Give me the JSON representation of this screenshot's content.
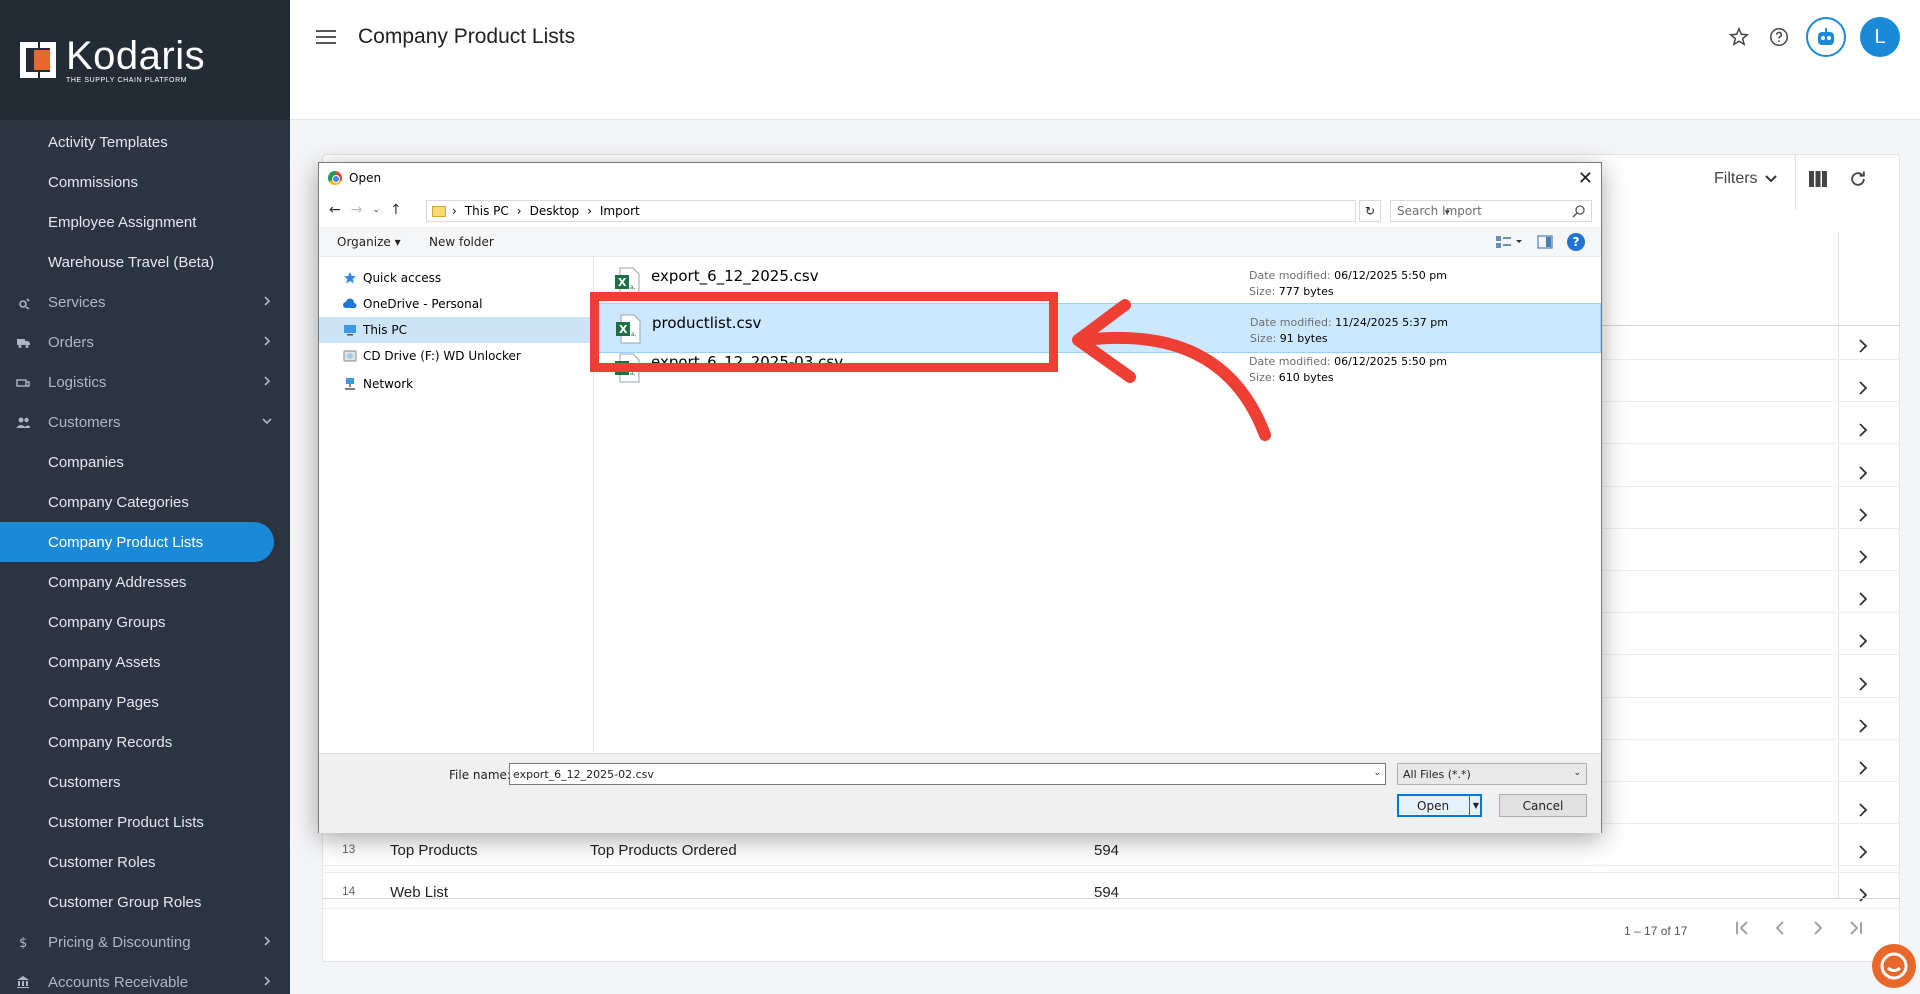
{
  "brand": {
    "name": "Kodaris",
    "tagline": "THE SUPPLY CHAIN PLATFORM",
    "accent": "#1a8ad8",
    "logo_orange": "#e8672a"
  },
  "sidebar": {
    "items": [
      {
        "label": "Activity Templates",
        "kind": "sub"
      },
      {
        "label": "Commissions",
        "kind": "sub"
      },
      {
        "label": "Employee Assignment",
        "kind": "sub"
      },
      {
        "label": "Warehouse Travel (Beta)",
        "kind": "sub"
      },
      {
        "label": "Services",
        "kind": "top",
        "icon": "services-icon"
      },
      {
        "label": "Orders",
        "kind": "top",
        "icon": "truck-icon"
      },
      {
        "label": "Logistics",
        "kind": "top",
        "icon": "logistics-icon"
      },
      {
        "label": "Customers",
        "kind": "top",
        "icon": "people-icon",
        "expanded": true
      },
      {
        "label": "Companies",
        "kind": "sub"
      },
      {
        "label": "Company Categories",
        "kind": "sub"
      },
      {
        "label": "Company Product Lists",
        "kind": "sub",
        "active": true
      },
      {
        "label": "Company Addresses",
        "kind": "sub"
      },
      {
        "label": "Company Groups",
        "kind": "sub"
      },
      {
        "label": "Company Assets",
        "kind": "sub"
      },
      {
        "label": "Company Pages",
        "kind": "sub"
      },
      {
        "label": "Company Records",
        "kind": "sub"
      },
      {
        "label": "Customers",
        "kind": "sub"
      },
      {
        "label": "Customer Product Lists",
        "kind": "sub"
      },
      {
        "label": "Customer Roles",
        "kind": "sub"
      },
      {
        "label": "Customer Group Roles",
        "kind": "sub"
      },
      {
        "label": "Pricing & Discounting",
        "kind": "top",
        "icon": "dollar-icon"
      },
      {
        "label": "Accounts Receivable",
        "kind": "top",
        "icon": "bank-icon"
      }
    ]
  },
  "header": {
    "title": "Company Product Lists",
    "avatar_initial": "L"
  },
  "toolbar": {
    "filters_label": "Filters"
  },
  "table": {
    "rows": [
      {
        "num": "13",
        "name": "Top Products",
        "description": "Top Products Ordered",
        "count": "594"
      },
      {
        "num": "14",
        "name": "Web List",
        "description": "",
        "count": "594"
      }
    ],
    "pagination": "1 – 17 of 17"
  },
  "dialog": {
    "title": "Open",
    "breadcrumb": [
      "This PC",
      "Desktop",
      "Import"
    ],
    "search_placeholder": "Search Import",
    "organize_label": "Organize",
    "new_folder_label": "New folder",
    "nav_items": [
      {
        "label": "Quick access",
        "icon": "star-icon"
      },
      {
        "label": "OneDrive - Personal",
        "icon": "cloud-icon"
      },
      {
        "label": "This PC",
        "icon": "computer-icon",
        "selected": true
      },
      {
        "label": "CD Drive (F:) WD Unlocker",
        "icon": "cd-drive-icon"
      },
      {
        "label": "Network",
        "icon": "network-icon"
      }
    ],
    "files": [
      {
        "name": "export_6_12_2025.csv",
        "date_label": "Date modified:",
        "date": "06/12/2025 5:50 pm",
        "size_label": "Size:",
        "size": "777 bytes"
      },
      {
        "name": "productlist.csv",
        "date_label": "Date modified:",
        "date": "11/24/2025 5:37 pm",
        "size_label": "Size:",
        "size": "91 bytes",
        "selected": true
      },
      {
        "name": "export_6_12_2025-03.csv",
        "date_label": "Date modified:",
        "date": "06/12/2025 5:50 pm",
        "size_label": "Size:",
        "size": "610 bytes"
      }
    ],
    "file_name_label": "File name:",
    "file_name_value": "export_6_12_2025-02.csv",
    "file_type": "All Files (*.*)",
    "open_label": "Open",
    "cancel_label": "Cancel"
  },
  "annotation": {
    "color": "#ef3f35"
  }
}
